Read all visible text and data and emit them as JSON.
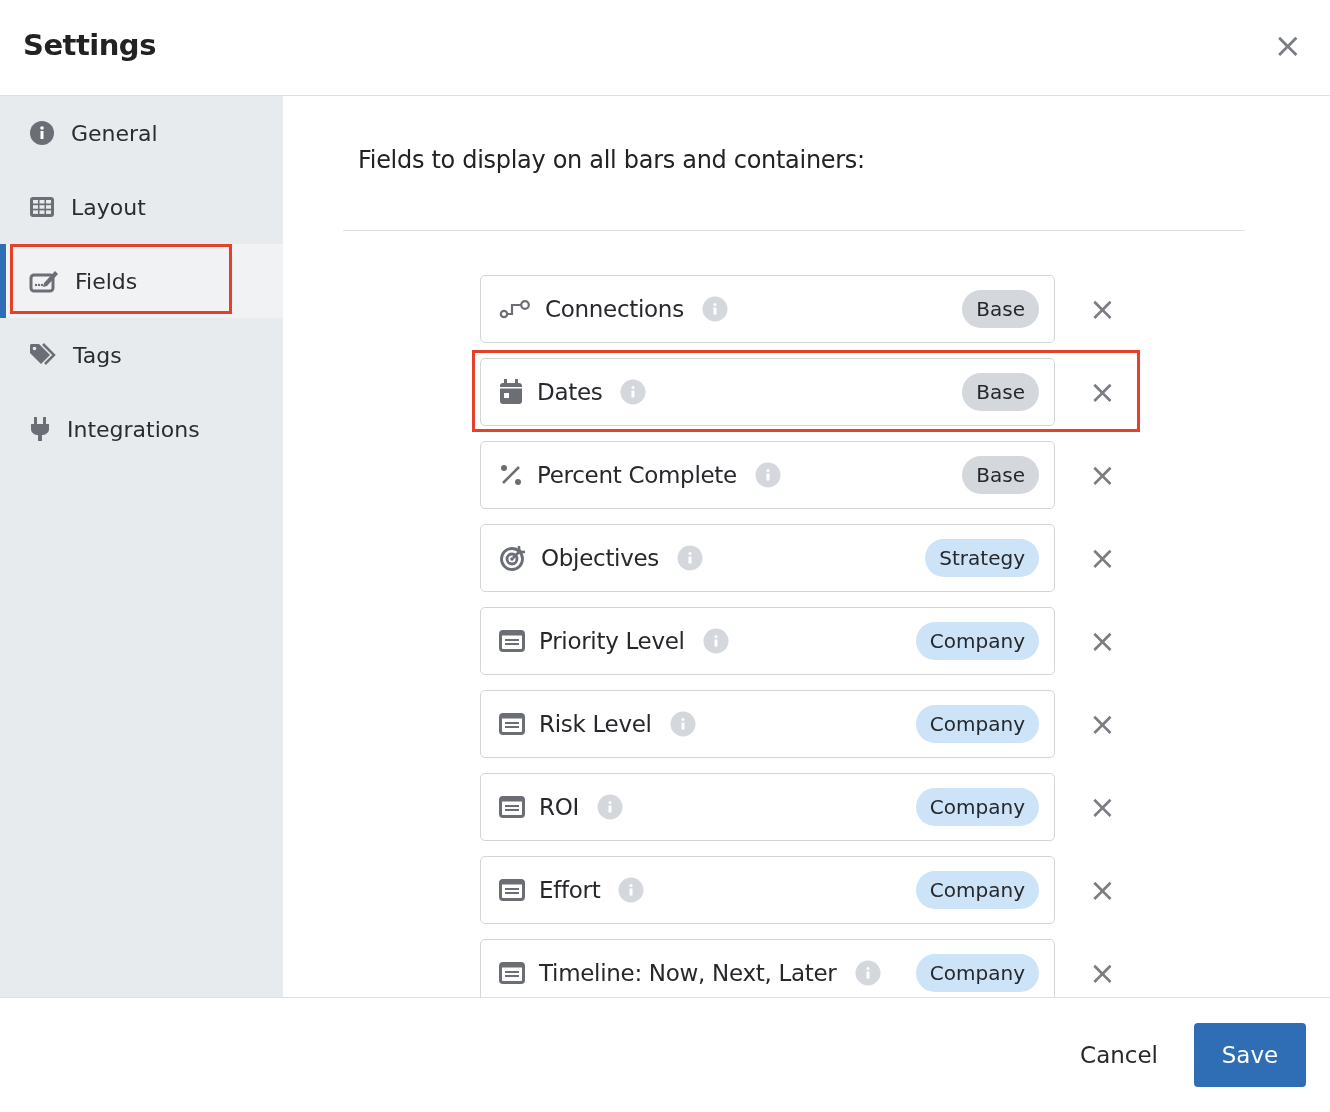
{
  "dialog": {
    "title": "Settings",
    "close": "×"
  },
  "sidebar": {
    "items": [
      {
        "label": "General",
        "kind": "info",
        "selected": false,
        "highlighted": false
      },
      {
        "label": "Layout",
        "kind": "grid",
        "selected": false,
        "highlighted": false
      },
      {
        "label": "Fields",
        "kind": "fields",
        "selected": true,
        "highlighted": true
      },
      {
        "label": "Tags",
        "kind": "tags",
        "selected": false,
        "highlighted": false
      },
      {
        "label": "Integrations",
        "kind": "plug",
        "selected": false,
        "highlighted": false
      }
    ]
  },
  "content": {
    "heading": "Fields to display on all bars and containers:",
    "fields": [
      {
        "name": "Connections",
        "kind": "connections",
        "badge": {
          "label": "Base",
          "kind": "base"
        },
        "highlighted": false,
        "remove": "×"
      },
      {
        "name": "Dates",
        "kind": "dates",
        "badge": {
          "label": "Base",
          "kind": "base"
        },
        "highlighted": true,
        "remove": "×"
      },
      {
        "name": "Percent Complete",
        "kind": "percent",
        "badge": {
          "label": "Base",
          "kind": "base"
        },
        "highlighted": false,
        "remove": "×"
      },
      {
        "name": "Objectives",
        "kind": "objectives",
        "badge": {
          "label": "Strategy",
          "kind": "tier"
        },
        "highlighted": false,
        "remove": "×"
      },
      {
        "name": "Priority Level",
        "kind": "custom",
        "badge": {
          "label": "Company",
          "kind": "tier"
        },
        "highlighted": false,
        "remove": "×"
      },
      {
        "name": "Risk Level",
        "kind": "custom",
        "badge": {
          "label": "Company",
          "kind": "tier"
        },
        "highlighted": false,
        "remove": "×"
      },
      {
        "name": "ROI",
        "kind": "custom",
        "badge": {
          "label": "Company",
          "kind": "tier"
        },
        "highlighted": false,
        "remove": "×"
      },
      {
        "name": "Effort",
        "kind": "custom",
        "badge": {
          "label": "Company",
          "kind": "tier"
        },
        "highlighted": false,
        "remove": "×"
      },
      {
        "name": "Timeline: Now, Next, Later",
        "kind": "custom",
        "badge": {
          "label": "Company",
          "kind": "tier"
        },
        "highlighted": false,
        "remove": "×"
      }
    ]
  },
  "footer": {
    "buttons": [
      {
        "label": "Cancel",
        "kind": "secondary"
      },
      {
        "label": "Save",
        "kind": "primary"
      }
    ]
  }
}
